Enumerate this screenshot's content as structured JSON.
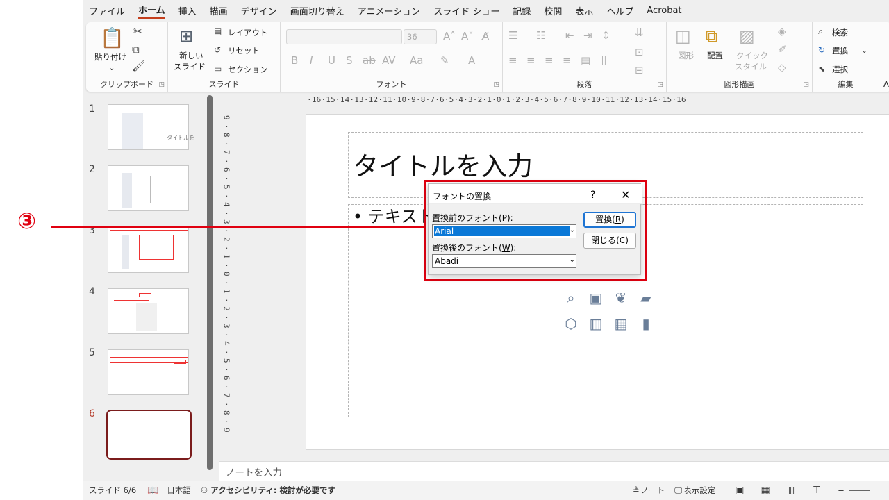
{
  "menu": {
    "tabs": [
      "ファイル",
      "ホーム",
      "挿入",
      "描画",
      "デザイン",
      "画面切り替え",
      "アニメーション",
      "スライド ショー",
      "記録",
      "校閲",
      "表示",
      "ヘルプ",
      "Acrobat"
    ],
    "active_tab": "ホーム"
  },
  "ribbon": {
    "clipboard": {
      "paste": "貼り付け",
      "label": "クリップボード"
    },
    "slides": {
      "new_slide_1": "新しい",
      "new_slide_2": "スライド",
      "layout": "レイアウト",
      "reset": "リセット",
      "section": "セクション",
      "label": "スライド"
    },
    "font": {
      "size": "36",
      "label": "フォント"
    },
    "paragraph": {
      "label": "段落"
    },
    "drawing": {
      "shapes": "図形",
      "arrange": "配置",
      "quick_1": "クイック",
      "quick_2": "スタイル",
      "label": "図形描画"
    },
    "editing": {
      "find": "検索",
      "replace": "置換",
      "select": "選択",
      "label": "編集"
    },
    "extra": "Ac"
  },
  "thumbnails": {
    "numbers": [
      "1",
      "2",
      "3",
      "4",
      "5",
      "6"
    ],
    "t1_text": "タイトルを"
  },
  "ruler": {
    "horizontal": "·16·15·14·13·12·11·10·9·8·7·6·5·4·3·2·1·0·1·2·3·4·5·6·7·8·9·10·11·12·13·14·15·16",
    "vertical": [
      "9",
      "·",
      "8",
      "·",
      "7",
      "·",
      "6",
      "·",
      "5",
      "·",
      "4",
      "·",
      "3",
      "·",
      "2",
      "·",
      "1",
      "·",
      "0",
      "·",
      "1",
      "·",
      "2",
      "·",
      "3",
      "·",
      "4",
      "·",
      "5",
      "·",
      "6",
      "·",
      "7",
      "·",
      "8",
      "·",
      "9"
    ]
  },
  "slide": {
    "title_text": "タイトルを入力",
    "body_text": "• テキスト"
  },
  "dialog": {
    "title": "フォントの置換",
    "help": "?",
    "close": "✕",
    "from_label_pre": "置換前のフォント(",
    "from_label_key": "P",
    "from_label_post": "):",
    "from_value": "Arial",
    "to_label_pre": "置換後のフォント(",
    "to_label_key": "W",
    "to_label_post": "):",
    "to_value": "Abadi",
    "replace_pre": "置換(",
    "replace_key": "R",
    "replace_post": ")",
    "close_pre": "閉じる(",
    "close_key": "C",
    "close_post": ")"
  },
  "annotation": {
    "marker": "③",
    "color": "#e00010"
  },
  "notes": {
    "placeholder": "ノートを入力"
  },
  "status": {
    "slide": "スライド 6/6",
    "language": "日本語",
    "accessibility": "アクセシビリティ: 検討が必要です",
    "notes": "ノート",
    "display_settings": "表示設定"
  },
  "colors": {
    "accent": "#c43e1c",
    "selection": "#0a78d7",
    "annotation": "#e00010"
  }
}
